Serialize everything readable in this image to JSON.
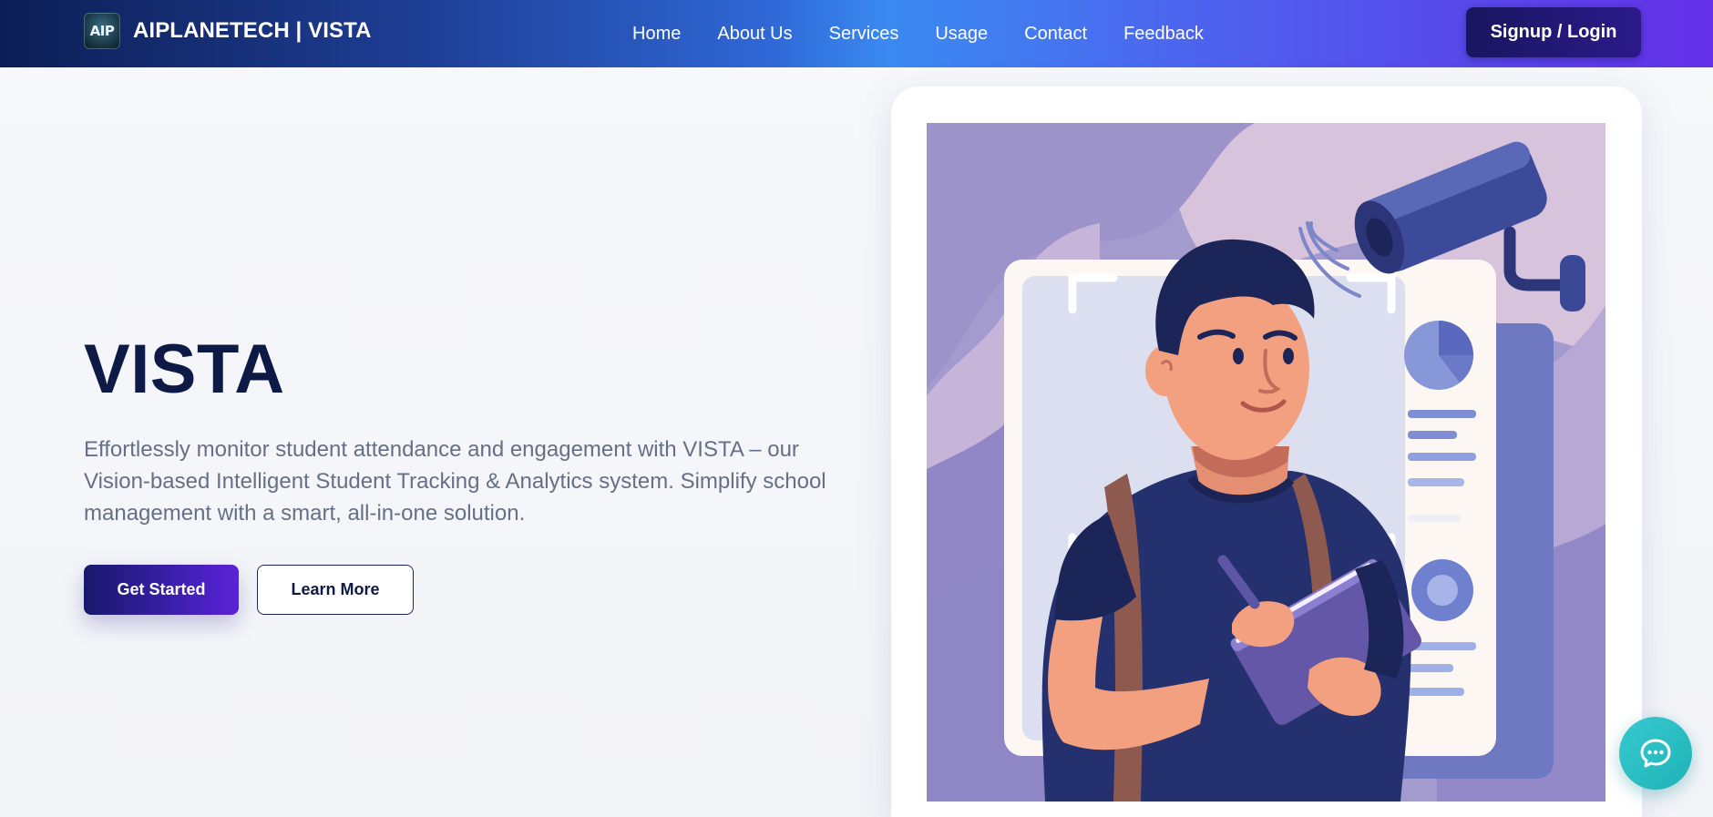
{
  "brand": {
    "logo_text": "AIP",
    "name": "AIPLANETECH | VISTA"
  },
  "nav": {
    "links": [
      "Home",
      "About Us",
      "Services",
      "Usage",
      "Contact",
      "Feedback"
    ],
    "login_label": "Signup / Login"
  },
  "hero": {
    "title": "VISTA",
    "description": "Effortlessly monitor student attendance and engagement with VISTA – our Vision-based Intelligent Student Tracking & Analytics system. Simplify school management with a smart, all-in-one solution.",
    "primary_button": "Get Started",
    "secondary_button": "Learn More"
  },
  "illustration": {
    "subject": "student-with-tablet",
    "camera_icon": "security-camera-icon"
  },
  "chat": {
    "icon": "chat-bubble-icon"
  },
  "colors": {
    "nav_start": "#0c1e55",
    "nav_end": "#6330e8",
    "title": "#0d1a45",
    "body_text": "#667085",
    "chat": "#2ec2c8"
  }
}
